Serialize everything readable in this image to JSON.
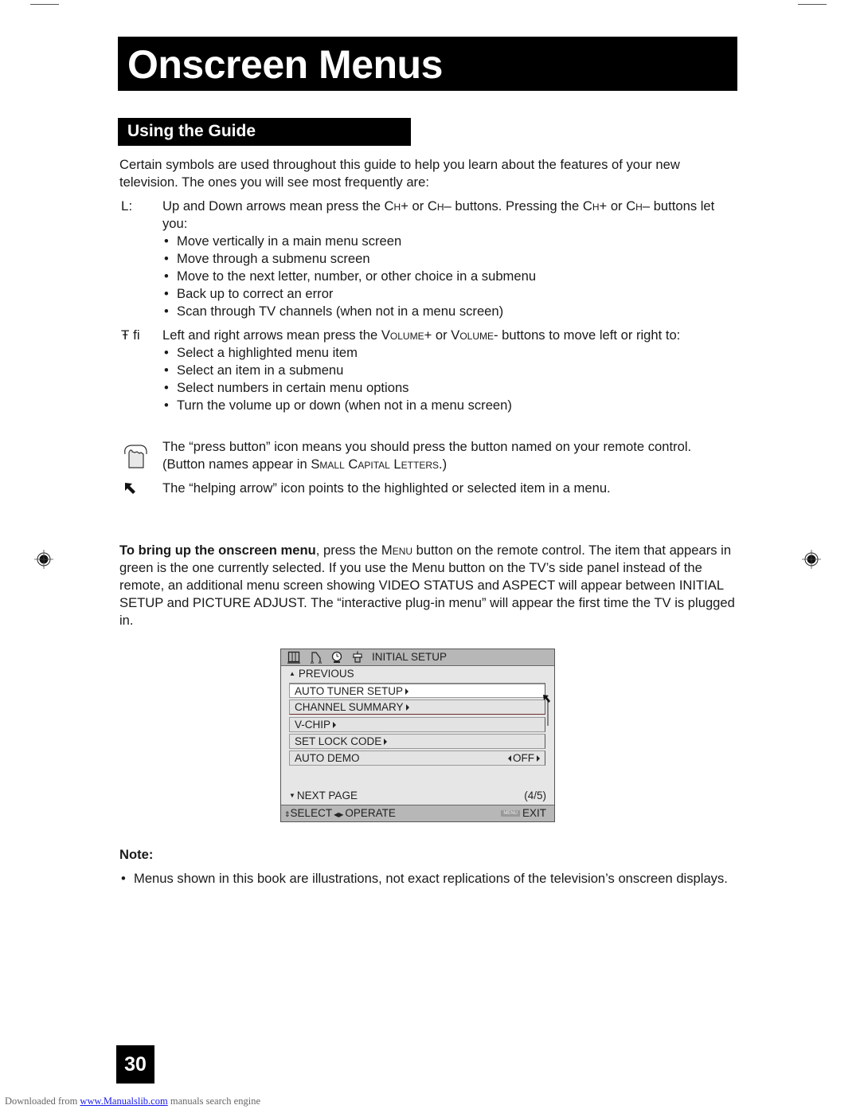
{
  "header": {
    "title": "Onscreen Menus",
    "section_title": "Using the Guide"
  },
  "intro": "Certain symbols are used throughout this guide to help you learn about the features of your new television. The ones you will see most frequently are:",
  "symbols": [
    {
      "glyph": "L:",
      "icon": "up-down-arrows-icon",
      "text_parts": [
        "Up and Down arrows mean press the ",
        "Ch",
        "+ or ",
        "Ch",
        "– buttons. Pressing the ",
        "Ch",
        "+ or ",
        "Ch",
        "– buttons let you:"
      ],
      "bullets": [
        "Move vertically in a main menu screen",
        "Move through a submenu screen",
        "Move to the next letter, number, or other choice in a submenu",
        "Back up to correct an error",
        "Scan through TV channels (when not in a menu screen)"
      ]
    },
    {
      "glyph": "Ŧ fi",
      "icon": "left-right-arrows-icon",
      "text_parts": [
        "Left and right arrows mean press the ",
        "Volume",
        "+ or ",
        "Volume",
        "- buttons to move left or right to:"
      ],
      "bullets": [
        "Select a highlighted menu item",
        "Select an item in a submenu",
        "Select numbers in certain menu options",
        "Turn the volume up or down (when not in a menu screen)"
      ]
    },
    {
      "icon": "press-button-icon",
      "text_parts": [
        "The “press button” icon means you should press the button named on your remote control. (Button names appear in ",
        "Small Capital Letters",
        ".)"
      ]
    },
    {
      "icon": "helping-arrow-icon",
      "text": "The “helping arrow” icon points to the highlighted or selected item in a menu."
    }
  ],
  "menu_paragraph": {
    "bold_lead": "To bring up the onscreen menu",
    "part1": ", press the ",
    "menu_sc": "Menu",
    "part2": " button on the remote control. The item that appears in green is the one currently selected. If you use the Menu button on the TV’s side panel instead of the remote, an additional menu screen showing VIDEO STATUS and ASPECT will appear between INITIAL SETUP and PICTURE ADJUST. The “interactive plug-in menu” will appear the first time the TV is plugged in."
  },
  "tv_menu": {
    "header_icons": [
      "picture-icon",
      "sound-icon",
      "clock-icon",
      "setup-icon"
    ],
    "title": "INITIAL SETUP",
    "previous": "PREVIOUS",
    "items": [
      {
        "label": "AUTO TUNER SETUP",
        "selected": true
      },
      {
        "label": "CHANNEL SUMMARY",
        "selected": false
      },
      {
        "label": "V-CHIP",
        "selected": false
      },
      {
        "label": "SET LOCK CODE",
        "selected": false
      },
      {
        "label": "AUTO DEMO",
        "value": "OFF",
        "selected": false
      }
    ],
    "next_page": "NEXT PAGE",
    "page_indicator": "(4/5)",
    "footer_select": "SELECT",
    "footer_operate": "OPERATE",
    "footer_menu_key": "MENU",
    "footer_exit": "EXIT"
  },
  "note": {
    "label": "Note:",
    "bullets": [
      "Menus shown in this book are illustrations, not exact replications of the television’s onscreen displays."
    ]
  },
  "page_number": "30",
  "footer": {
    "prefix": "Downloaded from ",
    "link": "www.Manualslib.com",
    "suffix": " manuals search engine"
  }
}
